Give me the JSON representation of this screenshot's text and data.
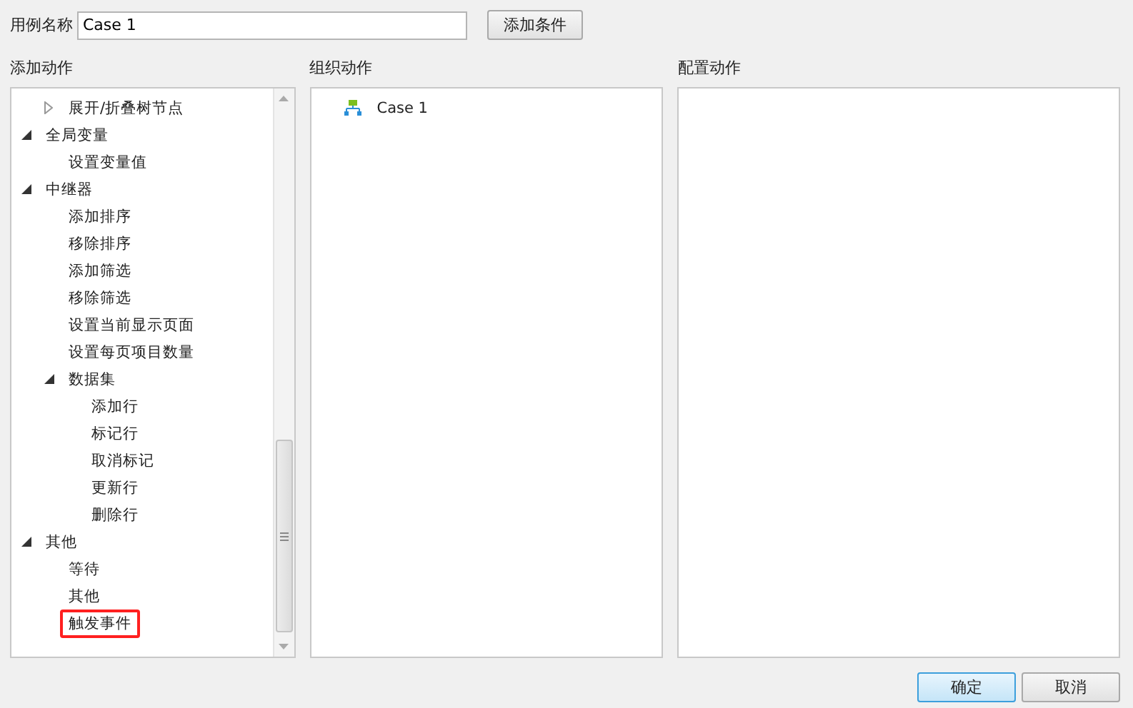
{
  "case_name": {
    "label": "用例名称",
    "value": "Case 1"
  },
  "add_condition_button": "添加条件",
  "add_actions": {
    "title": "添加动作",
    "items": [
      {
        "children": [
          {
            "label": "展开/折叠树节点",
            "expanded": false
          }
        ]
      },
      {
        "label": "全局变量",
        "expanded": true,
        "children": [
          {
            "label": "设置变量值"
          }
        ]
      },
      {
        "label": "中继器",
        "expanded": true,
        "children": [
          {
            "label": "添加排序"
          },
          {
            "label": "移除排序"
          },
          {
            "label": "添加筛选"
          },
          {
            "label": "移除筛选"
          },
          {
            "label": "设置当前显示页面"
          },
          {
            "label": "设置每页项目数量"
          },
          {
            "label": "数据集",
            "expanded": true,
            "children": [
              {
                "label": "添加行"
              },
              {
                "label": "标记行"
              },
              {
                "label": "取消标记"
              },
              {
                "label": "更新行"
              },
              {
                "label": "删除行"
              }
            ]
          }
        ]
      },
      {
        "label": "其他",
        "expanded": true,
        "children": [
          {
            "label": "等待"
          },
          {
            "label": "其他"
          },
          {
            "label": "触发事件",
            "highlighted": true
          }
        ]
      }
    ]
  },
  "organize_actions": {
    "title": "组织动作",
    "cases": [
      {
        "label": "Case 1"
      }
    ]
  },
  "configure_actions": {
    "title": "配置动作"
  },
  "buttons": [
    {
      "label": "确定",
      "kind": "primary"
    },
    {
      "label": "取消",
      "kind": "normal"
    }
  ]
}
